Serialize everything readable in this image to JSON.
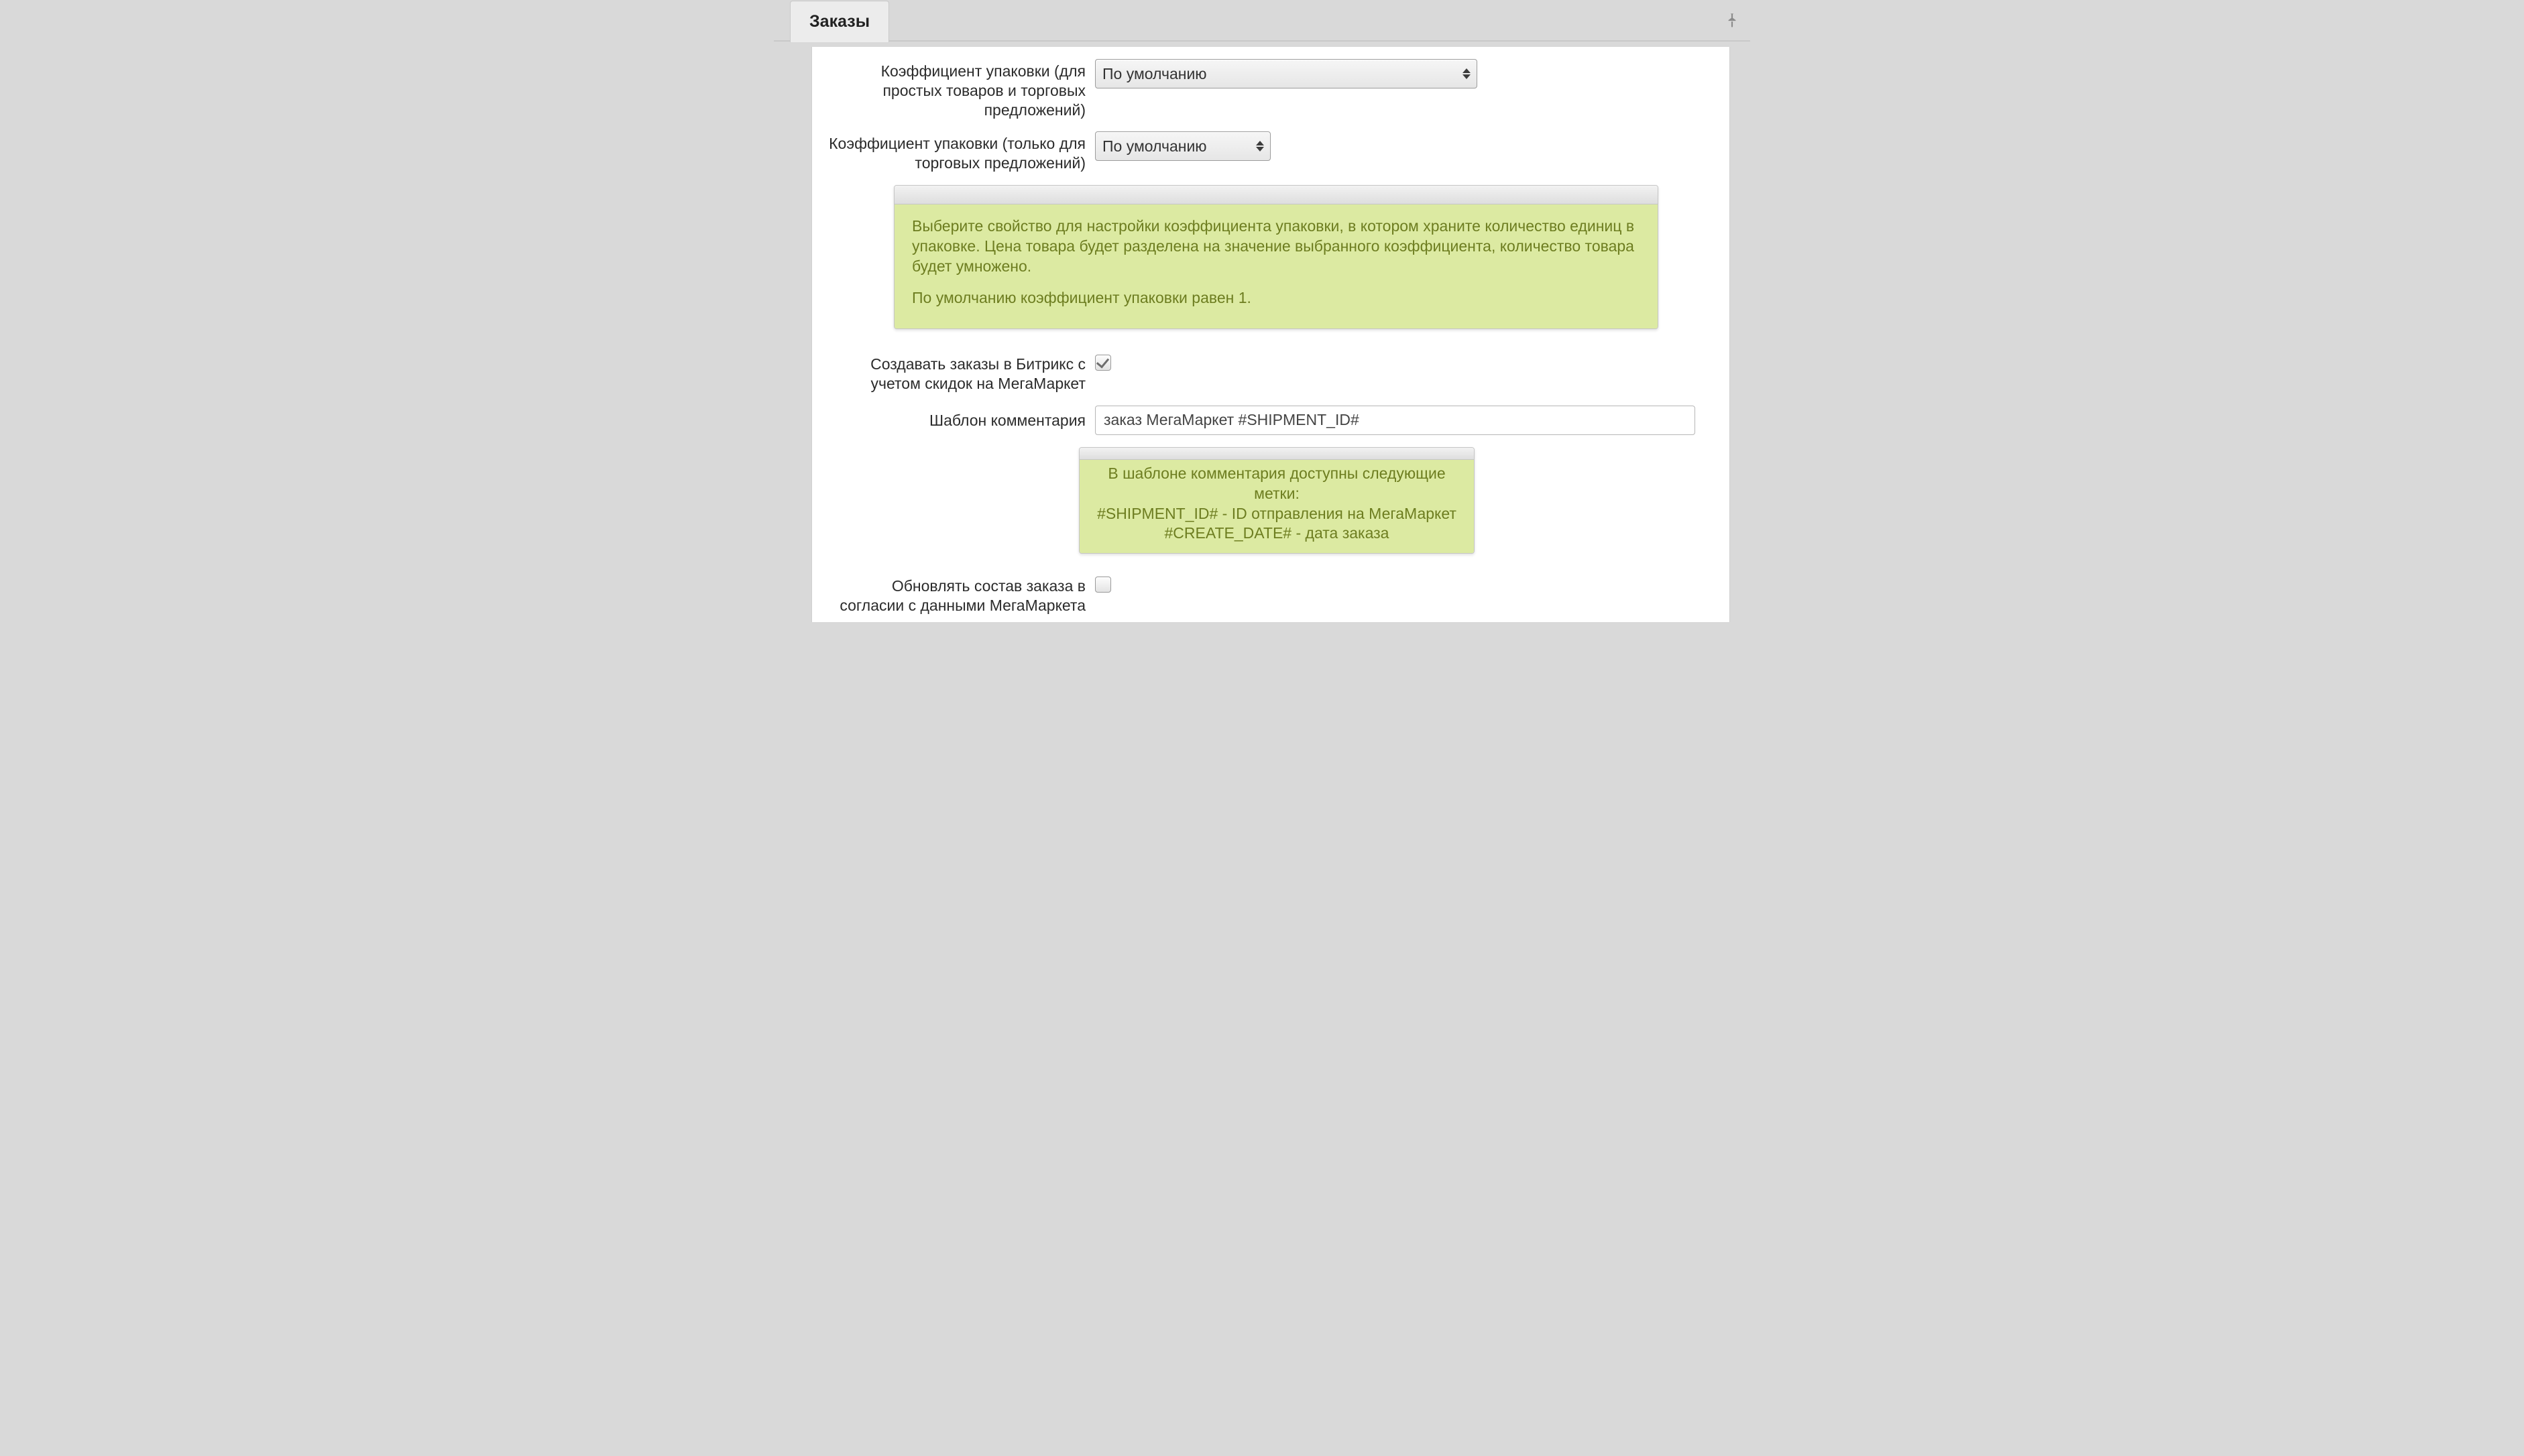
{
  "tab": {
    "title": "Заказы"
  },
  "fields": {
    "pack_coef_all": {
      "label": "Коэффициент упаковки (для простых товаров и торговых предложений)",
      "value": "По умолчанию"
    },
    "pack_coef_offers": {
      "label": "Коэффициент упаковки (только для торговых предложений)",
      "value": "По умолчанию"
    },
    "pack_note": {
      "p1": "Выберите свойство для настройки коэффициента упаковки, в котором храните количество единиц в упаковке. Цена товара будет разделена на значение выбранного коэффициента, количество товара будет умножено.",
      "p2": "По умолчанию коэффициент упаковки равен 1."
    },
    "create_with_discounts": {
      "label": "Создавать заказы в Битрикс с учетом скидок на МегаМаркет",
      "checked": true
    },
    "comment_template": {
      "label": "Шаблон комментария",
      "value": "заказ МегаМаркет #SHIPMENT_ID#"
    },
    "comment_note": {
      "l1": "В шаблоне комментария доступны следующие метки:",
      "l2": "#SHIPMENT_ID# - ID отправления на МегаМаркет",
      "l3": "#CREATE_DATE# - дата заказа"
    },
    "update_composition": {
      "label": "Обновлять состав заказа в согласии с данными МегаМаркета",
      "checked": false
    }
  }
}
